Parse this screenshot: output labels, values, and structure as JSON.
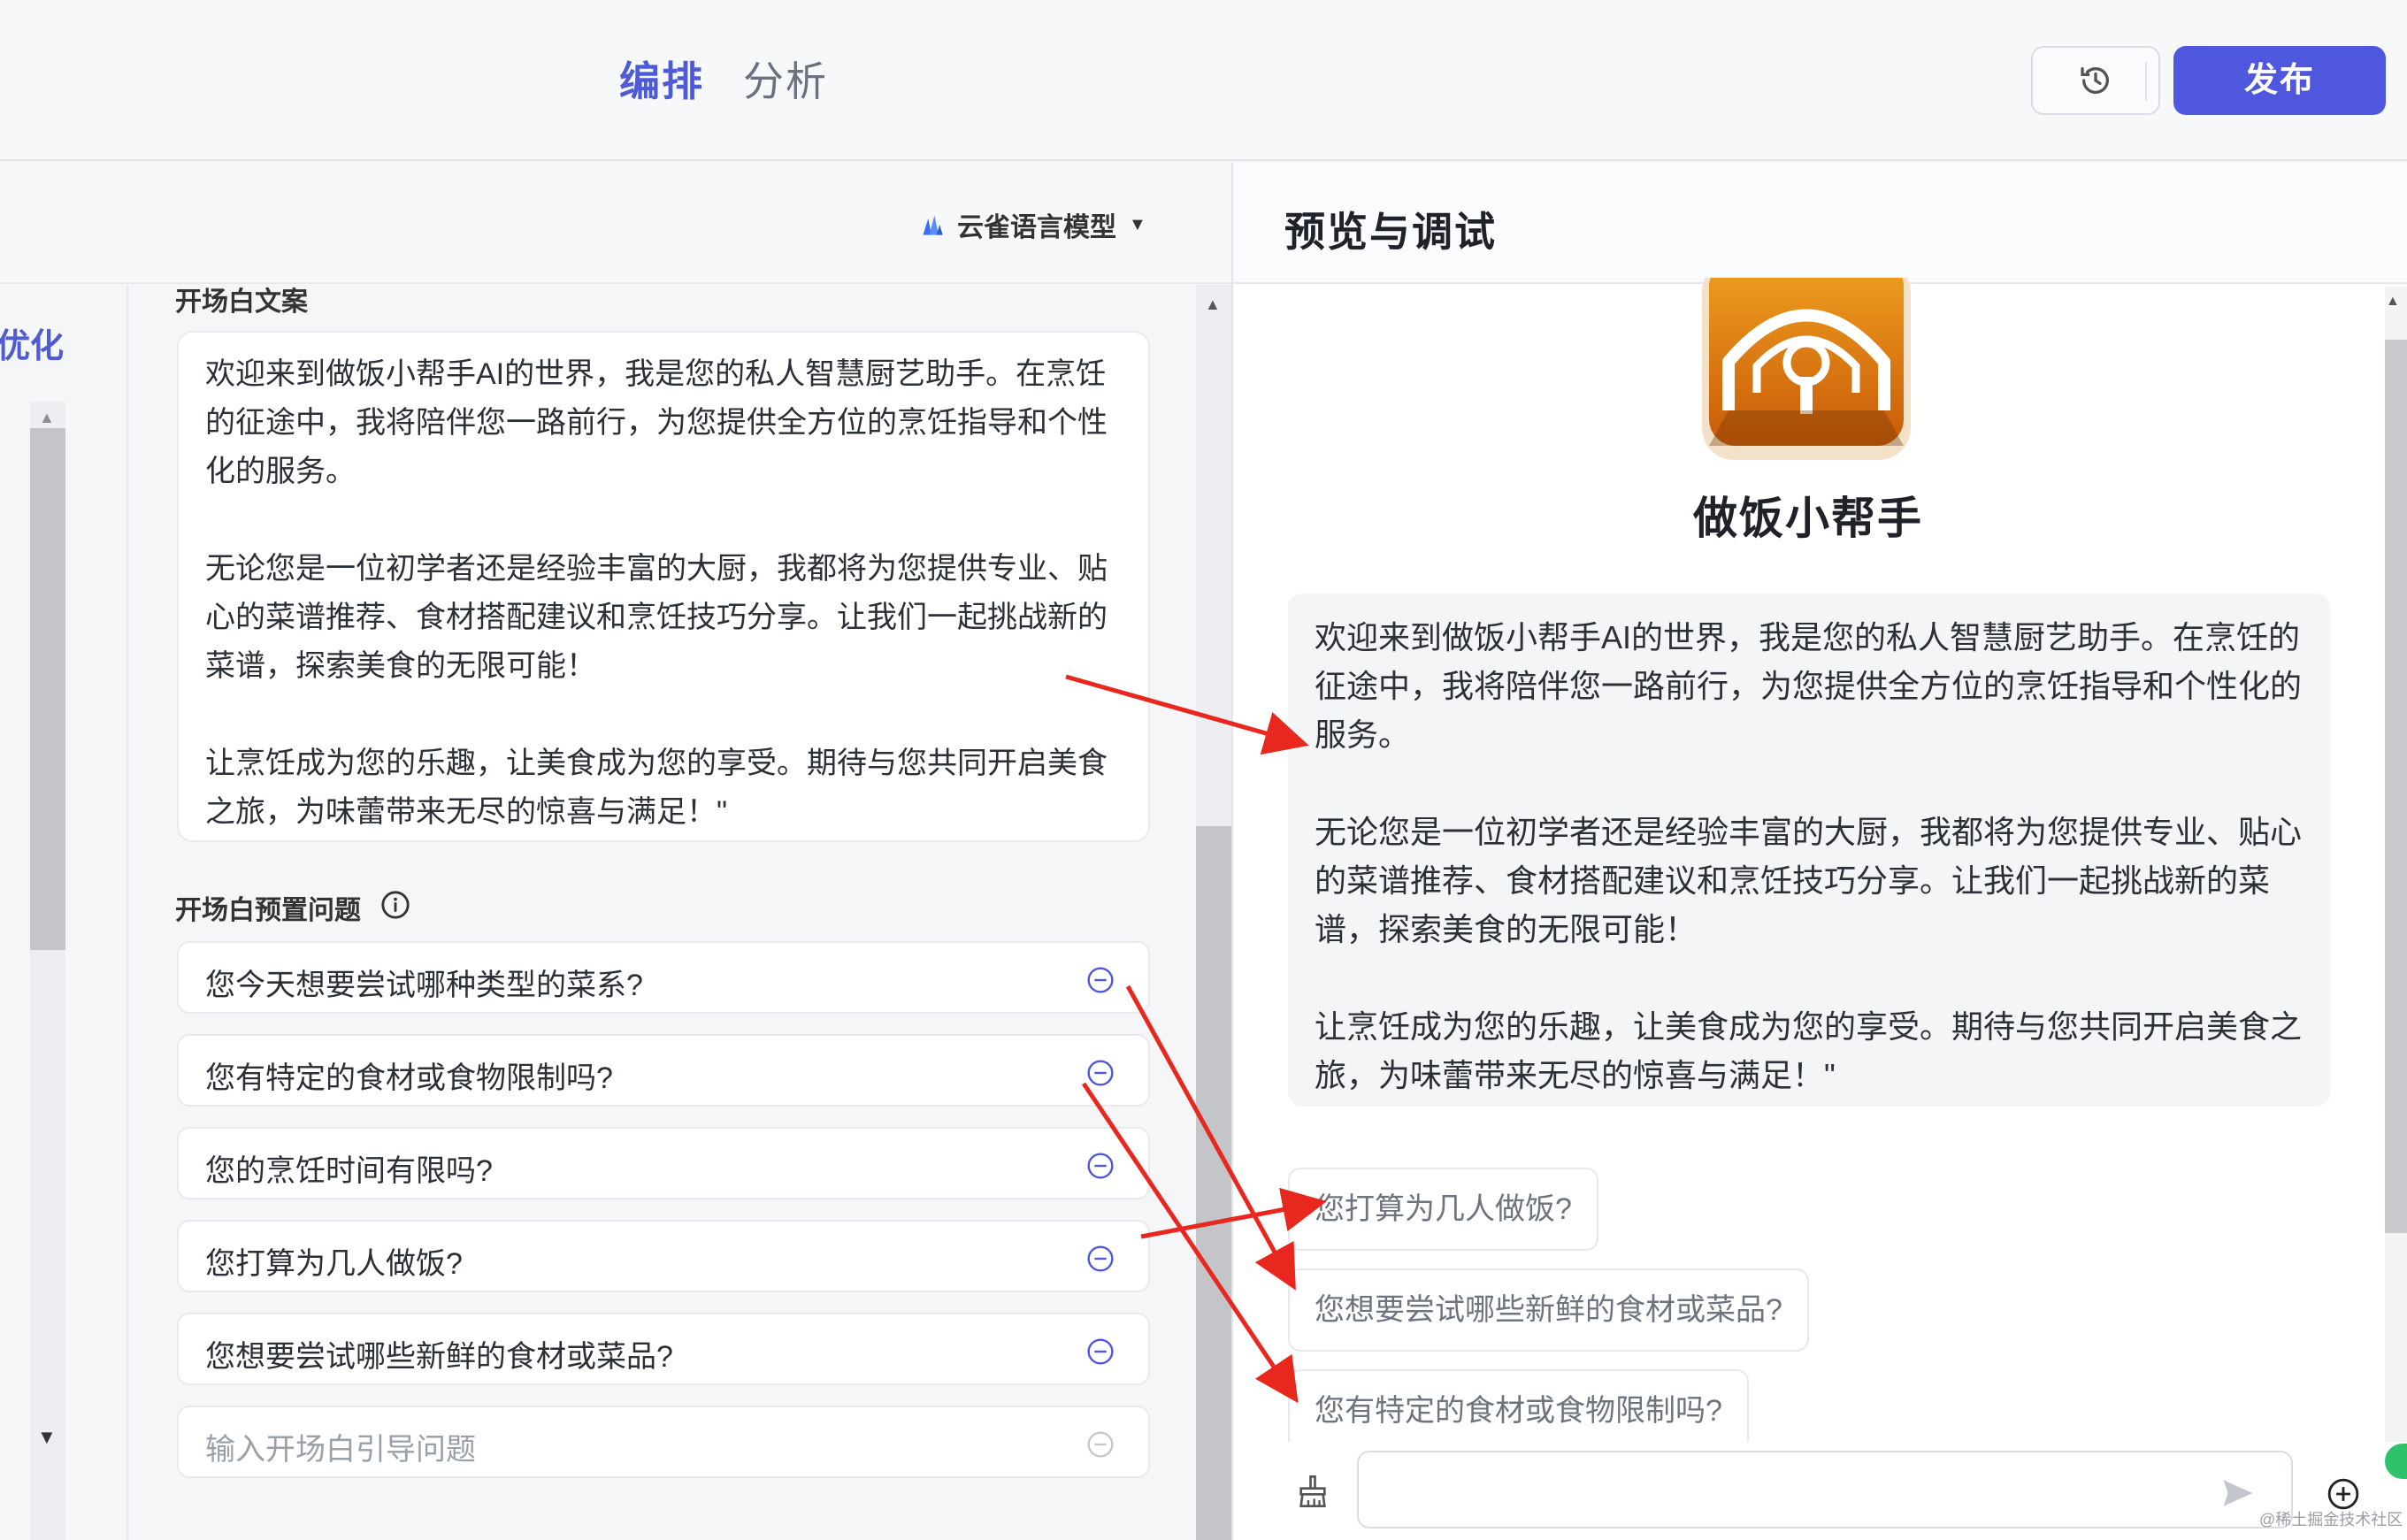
{
  "topbar": {
    "tabs": [
      {
        "label": "编排",
        "active": true
      },
      {
        "label": "分析",
        "active": false
      }
    ],
    "history_icon": "history-icon",
    "publish_label": "发布"
  },
  "editor": {
    "model_label": "云雀语言模型",
    "sidebar_label": "优化",
    "opening_text_title": "开场白文案",
    "opening_paragraphs": [
      "欢迎来到做饭小帮手AI的世界，我是您的私人智慧厨艺助手。在烹饪的征途中，我将陪伴您一路前行，为您提供全方位的烹饪指导和个性化的服务。",
      "无论您是一位初学者还是经验丰富的大厨，我都将为您提供专业、贴心的菜谱推荐、食材搭配建议和烹饪技巧分享。让我们一起挑战新的菜谱，探索美食的无限可能！",
      "让烹饪成为您的乐趣，让美食成为您的享受。期待与您共同开启美食之旅，为味蕾带来无尽的惊喜与满足！\""
    ],
    "preset_title": "开场白预置问题",
    "preset_questions": [
      "您今天想要尝试哪种类型的菜系?",
      "您有特定的食材或食物限制吗?",
      "您的烹饪时间有限吗?",
      "您打算为几人做饭?",
      "您想要尝试哪些新鲜的食材或菜品?"
    ],
    "question_placeholder": "输入开场白引导问题"
  },
  "preview": {
    "title": "预览与调试",
    "bot_name": "做饭小帮手",
    "welcome_paragraphs": [
      "欢迎来到做饭小帮手AI的世界，我是您的私人智慧厨艺助手。在烹饪的征途中，我将陪伴您一路前行，为您提供全方位的烹饪指导和个性化的服务。",
      "无论您是一位初学者还是经验丰富的大厨，我都将为您提供专业、贴心的菜谱推荐、食材搭配建议和烹饪技巧分享。让我们一起挑战新的菜谱，探索美食的无限可能！",
      "让烹饪成为您的乐趣，让美食成为您的享受。期待与您共同开启美食之旅，为味蕾带来无尽的惊喜与满足！\""
    ],
    "suggestions": [
      "您打算为几人做饭?",
      "您想要尝试哪些新鲜的食材或菜品?",
      "您有特定的食材或食物限制吗?"
    ],
    "watermark": "@稀土掘金技术社区"
  },
  "colors": {
    "accent": "#4f57de",
    "annotation_arrow": "#e8271f"
  }
}
